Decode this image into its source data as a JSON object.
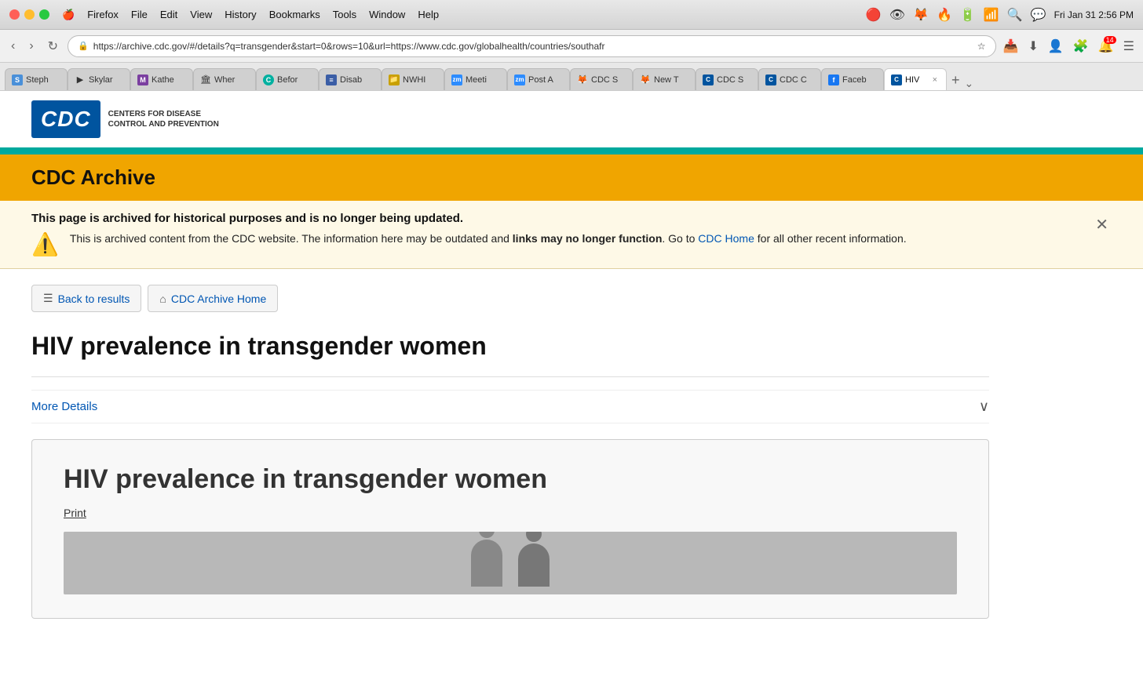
{
  "titlebar": {
    "app_name": "Firefox",
    "menus": [
      "Apple",
      "Firefox",
      "File",
      "Edit",
      "View",
      "History",
      "Bookmarks",
      "Tools",
      "Window",
      "Help"
    ],
    "time": "Fri Jan 31  2:56 PM"
  },
  "browser": {
    "url": "https://archive.cdc.gov/#/details?q=transgender&start=0&rows=10&url=https://www.cdc.gov/globalhealth/countries/southafr",
    "back_btn": "←",
    "forward_btn": "→",
    "refresh_btn": "↻"
  },
  "tabs": [
    {
      "label": "Steph",
      "favicon": "S",
      "active": false
    },
    {
      "label": "Skylar",
      "favicon": "▶",
      "active": false
    },
    {
      "label": "Kathe",
      "favicon": "M",
      "active": false
    },
    {
      "label": "Wher",
      "favicon": "🏛",
      "active": false
    },
    {
      "label": "Befor",
      "favicon": "C",
      "active": false
    },
    {
      "label": "Disab",
      "favicon": "≡",
      "active": false
    },
    {
      "label": "NWHI",
      "favicon": "📁",
      "active": false
    },
    {
      "label": "Meeti",
      "favicon": "zm",
      "active": false
    },
    {
      "label": "Post A",
      "favicon": "zm",
      "active": false
    },
    {
      "label": "CDC S",
      "favicon": "🦊",
      "active": false
    },
    {
      "label": "New T",
      "favicon": "🦊",
      "active": false
    },
    {
      "label": "CDC S",
      "favicon": "C",
      "active": false
    },
    {
      "label": "CDC C",
      "favicon": "C",
      "active": false
    },
    {
      "label": "Faceb",
      "favicon": "f",
      "active": false
    },
    {
      "label": "HIV ×",
      "favicon": "C",
      "active": true
    }
  ],
  "bookmarks": [
    {
      "label": "Steph",
      "favicon": "S"
    },
    {
      "label": "Skylar",
      "favicon": "▶"
    },
    {
      "label": "Kathe",
      "favicon": "M"
    },
    {
      "label": "Wher",
      "favicon": "🏛"
    },
    {
      "label": "Befor",
      "favicon": "C"
    },
    {
      "label": "Disab",
      "favicon": "≡"
    },
    {
      "label": "NWHI",
      "favicon": "📁"
    },
    {
      "label": "Meeti",
      "favicon": "zm"
    },
    {
      "label": "Post A",
      "favicon": "zm"
    },
    {
      "label": "CDC S",
      "favicon": "🦊"
    },
    {
      "label": "New T",
      "favicon": "🦊"
    },
    {
      "label": "CDC S",
      "favicon": "C"
    },
    {
      "label": "CDC C",
      "favicon": "C"
    }
  ],
  "cdc": {
    "logo_text": "CDC",
    "logo_label_line1": "CENTERS FOR DISEASE",
    "logo_label_line2": "CONTROL AND PREVENTION",
    "archive_title": "CDC Archive",
    "archive_banner_text": "This page is archived for historical purposes and is no longer being updated.",
    "archive_body_text": "This is archived content from the CDC website. The information here may be outdated and ",
    "archive_bold_text": "links may no longer function",
    "archive_suffix": ". Go to ",
    "cdc_home_link": "CDC Home",
    "archive_suffix2": " for all other recent information."
  },
  "page": {
    "back_btn_label": "Back to results",
    "archive_home_label": "CDC Archive Home",
    "page_title": "HIV prevalence in transgender women",
    "more_details_label": "More Details",
    "card_title": "HIV prevalence in transgender women",
    "print_label": "Print"
  }
}
